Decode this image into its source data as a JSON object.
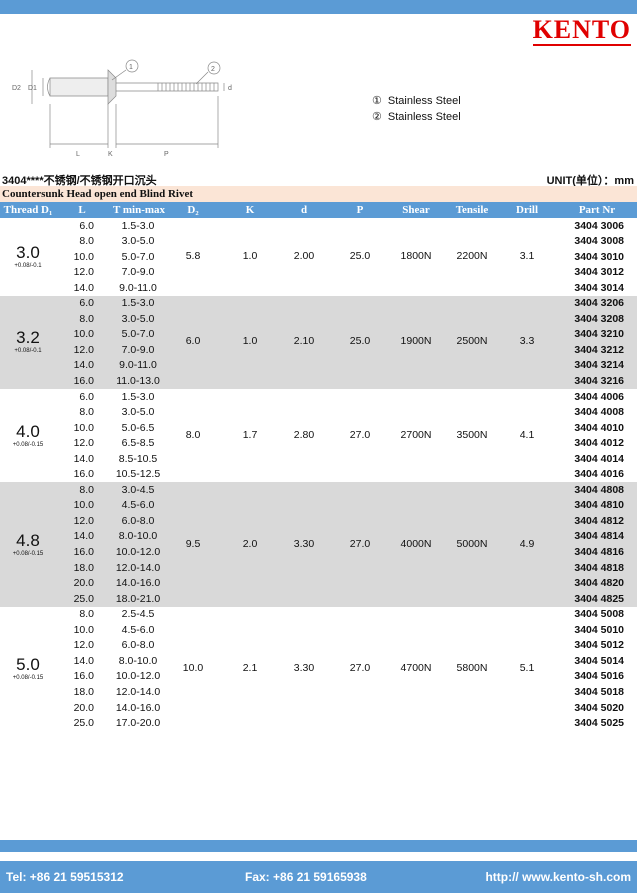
{
  "brand": "KENTO",
  "drawing": {
    "labels": {
      "d2": "D2",
      "d1": "D1",
      "l": "L",
      "k": "K",
      "p": "P",
      "d": "d",
      "c1": "1",
      "c2": "2"
    }
  },
  "materials": [
    {
      "num": "①",
      "name": "Stainless Steel"
    },
    {
      "num": "②",
      "name": "Stainless Steel"
    }
  ],
  "series_title": "3404****不锈钢/不锈钢开口沉头",
  "unit": "UNIT(单位）：mm",
  "product_title": "Countersunk Head open end Blind Rivet",
  "headers": [
    "Thread D₁",
    "L",
    "T min-max",
    "D₂",
    "K",
    "d",
    "P",
    "Shear",
    "Tensile",
    "Drill",
    "Part Nr"
  ],
  "groups": [
    {
      "thread": "3.0",
      "tol": "+0.08/-0.1",
      "d2": "5.8",
      "k": "1.0",
      "d": "2.00",
      "p": "25.0",
      "shear": "1800N",
      "tensile": "2200N",
      "drill": "3.1",
      "rows": [
        {
          "l": "6.0",
          "t": "1.5-3.0",
          "part": "3404 3006"
        },
        {
          "l": "8.0",
          "t": "3.0-5.0",
          "part": "3404 3008"
        },
        {
          "l": "10.0",
          "t": "5.0-7.0",
          "part": "3404 3010"
        },
        {
          "l": "12.0",
          "t": "7.0-9.0",
          "part": "3404 3012"
        },
        {
          "l": "14.0",
          "t": "9.0-11.0",
          "part": "3404 3014"
        }
      ]
    },
    {
      "thread": "3.2",
      "tol": "+0.08/-0.1",
      "d2": "6.0",
      "k": "1.0",
      "d": "2.10",
      "p": "25.0",
      "shear": "1900N",
      "tensile": "2500N",
      "drill": "3.3",
      "rows": [
        {
          "l": "6.0",
          "t": "1.5-3.0",
          "part": "3404 3206"
        },
        {
          "l": "8.0",
          "t": "3.0-5.0",
          "part": "3404 3208"
        },
        {
          "l": "10.0",
          "t": "5.0-7.0",
          "part": "3404 3210"
        },
        {
          "l": "12.0",
          "t": "7.0-9.0",
          "part": "3404 3212"
        },
        {
          "l": "14.0",
          "t": "9.0-11.0",
          "part": "3404 3214"
        },
        {
          "l": "16.0",
          "t": "11.0-13.0",
          "part": "3404 3216"
        }
      ]
    },
    {
      "thread": "4.0",
      "tol": "+0.08/-0.15",
      "d2": "8.0",
      "k": "1.7",
      "d": "2.80",
      "p": "27.0",
      "shear": "2700N",
      "tensile": "3500N",
      "drill": "4.1",
      "rows": [
        {
          "l": "6.0",
          "t": "1.5-3.0",
          "part": "3404 4006"
        },
        {
          "l": "8.0",
          "t": "3.0-5.0",
          "part": "3404 4008"
        },
        {
          "l": "10.0",
          "t": "5.0-6.5",
          "part": "3404 4010"
        },
        {
          "l": "12.0",
          "t": "6.5-8.5",
          "part": "3404 4012"
        },
        {
          "l": "14.0",
          "t": "8.5-10.5",
          "part": "3404 4014"
        },
        {
          "l": "16.0",
          "t": "10.5-12.5",
          "part": "3404 4016"
        }
      ]
    },
    {
      "thread": "4.8",
      "tol": "+0.08/-0.15",
      "d2": "9.5",
      "k": "2.0",
      "d": "3.30",
      "p": "27.0",
      "shear": "4000N",
      "tensile": "5000N",
      "drill": "4.9",
      "rows": [
        {
          "l": "8.0",
          "t": "3.0-4.5",
          "part": "3404 4808"
        },
        {
          "l": "10.0",
          "t": "4.5-6.0",
          "part": "3404 4810"
        },
        {
          "l": "12.0",
          "t": "6.0-8.0",
          "part": "3404 4812"
        },
        {
          "l": "14.0",
          "t": "8.0-10.0",
          "part": "3404 4814"
        },
        {
          "l": "16.0",
          "t": "10.0-12.0",
          "part": "3404 4816"
        },
        {
          "l": "18.0",
          "t": "12.0-14.0",
          "part": "3404 4818"
        },
        {
          "l": "20.0",
          "t": "14.0-16.0",
          "part": "3404 4820"
        },
        {
          "l": "25.0",
          "t": "18.0-21.0",
          "part": "3404 4825"
        }
      ]
    },
    {
      "thread": "5.0",
      "tol": "+0.08/-0.15",
      "d2": "10.0",
      "k": "2.1",
      "d": "3.30",
      "p": "27.0",
      "shear": "4700N",
      "tensile": "5800N",
      "drill": "5.1",
      "rows": [
        {
          "l": "8.0",
          "t": "2.5-4.5",
          "part": "3404 5008"
        },
        {
          "l": "10.0",
          "t": "4.5-6.0",
          "part": "3404 5010"
        },
        {
          "l": "12.0",
          "t": "6.0-8.0",
          "part": "3404 5012"
        },
        {
          "l": "14.0",
          "t": "8.0-10.0",
          "part": "3404 5014"
        },
        {
          "l": "16.0",
          "t": "10.0-12.0",
          "part": "3404 5016"
        },
        {
          "l": "18.0",
          "t": "12.0-14.0",
          "part": "3404 5018"
        },
        {
          "l": "20.0",
          "t": "14.0-16.0",
          "part": "3404 5020"
        },
        {
          "l": "25.0",
          "t": "17.0-20.0",
          "part": "3404 5025"
        }
      ]
    }
  ],
  "footer": {
    "tel": "Tel: +86 21 59515312",
    "fax": "Fax: +86 21 59165938",
    "web": "http:// www.kento-sh.com"
  }
}
